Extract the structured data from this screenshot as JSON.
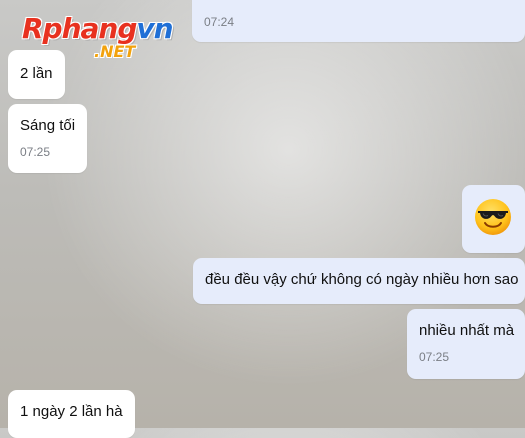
{
  "watermark": {
    "brand_red": "Rphang",
    "brand_blue": "vn",
    "suffix": ".NET"
  },
  "messages": [
    {
      "side": "out",
      "text": "",
      "time": "07:24"
    },
    {
      "side": "in",
      "text": "2 lần"
    },
    {
      "side": "in",
      "text": "Sáng tối",
      "time": "07:25"
    },
    {
      "side": "out",
      "emoji": "smiling-face-with-sunglasses"
    },
    {
      "side": "out",
      "text": "đều đều vậy chứ không có ngày nhiều hơn sao"
    },
    {
      "side": "out",
      "text": "nhiều nhất mà",
      "time": "07:25"
    },
    {
      "side": "in",
      "text": "1 ngày 2 lần hà"
    }
  ],
  "colors": {
    "incoming_bubble": "#ffffff",
    "outgoing_bubble": "#e6ecfb",
    "timestamp": "#7a7e85"
  }
}
